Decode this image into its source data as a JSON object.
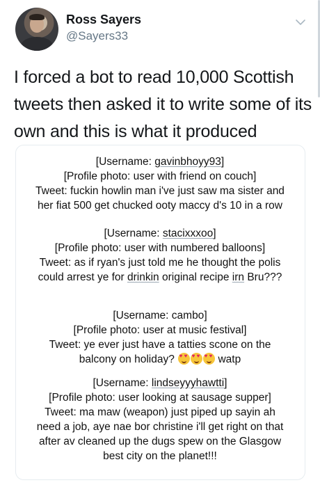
{
  "author": {
    "name": "Ross Sayers",
    "handle": "@Sayers33",
    "avatar_icon": "profile-photo"
  },
  "tweet": {
    "text": "I forced a bot to read 10,000 Scottish tweets then asked it to write some of its own and this is what it produced"
  },
  "card": {
    "tweets": [
      {
        "username_prefix": "[Username: ",
        "username": "gavinbhoyy93",
        "username_suffix": "]",
        "profile_photo": "[Profile photo: user with friend on couch]",
        "tweet_lines": [
          "Tweet: fuckin howlin man i've just saw ma sister and",
          "her fiat 500 get chucked ooty maccy d's 10 in a row"
        ]
      },
      {
        "username_prefix": "[Username: ",
        "username": "stacixxxoo",
        "username_suffix": "]",
        "profile_photo": "[Profile photo: user with numbered balloons]",
        "tweet_line1": "Tweet: as if ryan's just told me he thought the polis",
        "tweet_line2_a": "could arrest ye for ",
        "tweet_line2_u1": "drinkin",
        "tweet_line2_b": " original recipe ",
        "tweet_line2_u2": "irn",
        "tweet_line2_c": " Bru???"
      },
      {
        "username_prefix": "[Username: ",
        "username": "cambo",
        "username_suffix": "]",
        "profile_photo": "[Profile photo: user at music festival]",
        "tweet_line1": "Tweet: ye ever just have a tatties scone on the",
        "tweet_line2_a": "balcony on holiday?",
        "emoji_name": "heart-eyes-emoji",
        "tweet_line2_b": " watp"
      },
      {
        "username_prefix": "[Username: ",
        "username": "lindseyyyhawtti",
        "username_suffix": "]",
        "profile_photo": "[Profile photo: user looking at sausage supper]",
        "tweet_line1": "Tweet: ma maw (weapon) just piped up sayin ah",
        "tweet_line2": "need a job, aye nae bor christine i'll get right on that",
        "tweet_line3": "after av cleaned up the dugs spew on the Glasgow",
        "tweet_line4": "best city on the planet!!!"
      }
    ]
  },
  "colors": {
    "text": "#14171a",
    "secondary": "#657786",
    "border": "#e6ecf0"
  }
}
